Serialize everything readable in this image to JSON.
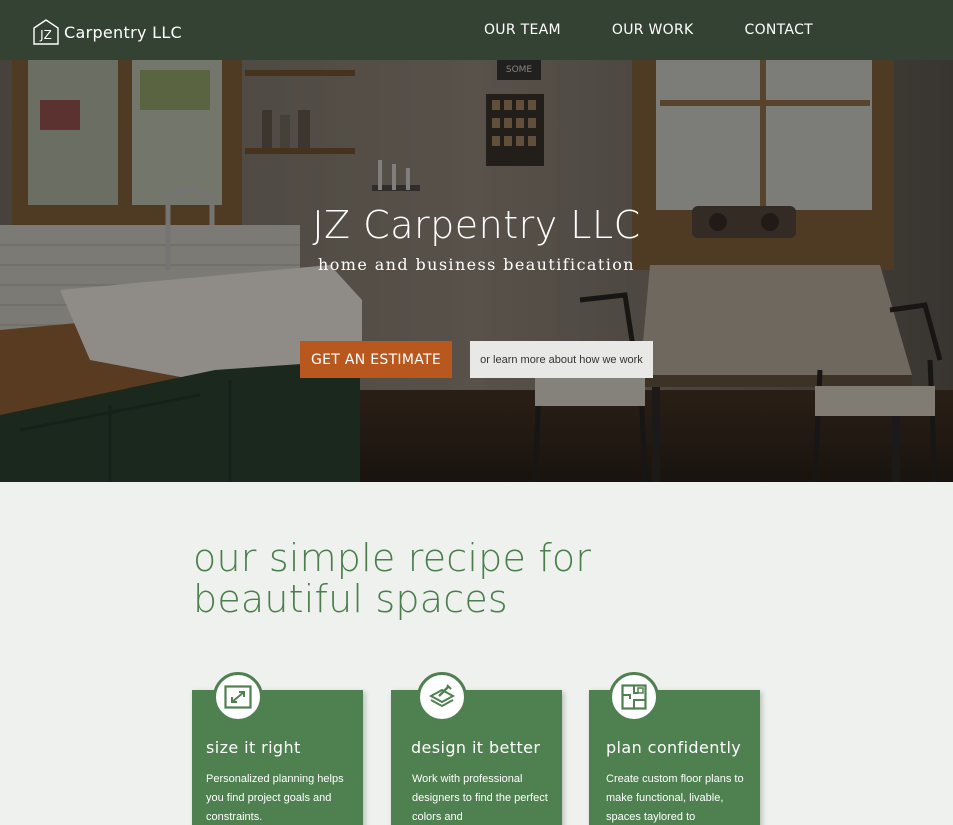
{
  "nav": {
    "logo_icon": "house-monogram-icon",
    "logo_letters": "JZ",
    "brand": "Carpentry LLC",
    "links": [
      "OUR TEAM",
      "OUR WORK",
      "CONTACT"
    ]
  },
  "hero": {
    "title": "JZ Carpentry LLC",
    "subtitle": "home and business beautification",
    "primary_button": "GET AN ESTIMATE",
    "secondary_button": "or learn more about how we work",
    "background_sign": "SOME"
  },
  "recipe": {
    "title_line1": "our simple recipe for",
    "title_line2": "beautiful spaces",
    "cards": [
      {
        "icon": "expand-frame-icon",
        "title": "size it right",
        "text": "Personalized planning helps you find project goals and constraints."
      },
      {
        "icon": "color-swatch-stack-icon",
        "title": "design it better",
        "text": "Work with professional designers to find the perfect colors and"
      },
      {
        "icon": "floor-plan-icon",
        "title": "plan confidently",
        "text": "Create custom floor plans to make functional, livable, spaces taylored to"
      }
    ]
  },
  "colors": {
    "nav_bg": "#334232",
    "accent_green": "#4e8050",
    "title_green": "#4a7f4b",
    "estimate_orange": "#b9581e",
    "page_bg": "#eef1ed"
  }
}
